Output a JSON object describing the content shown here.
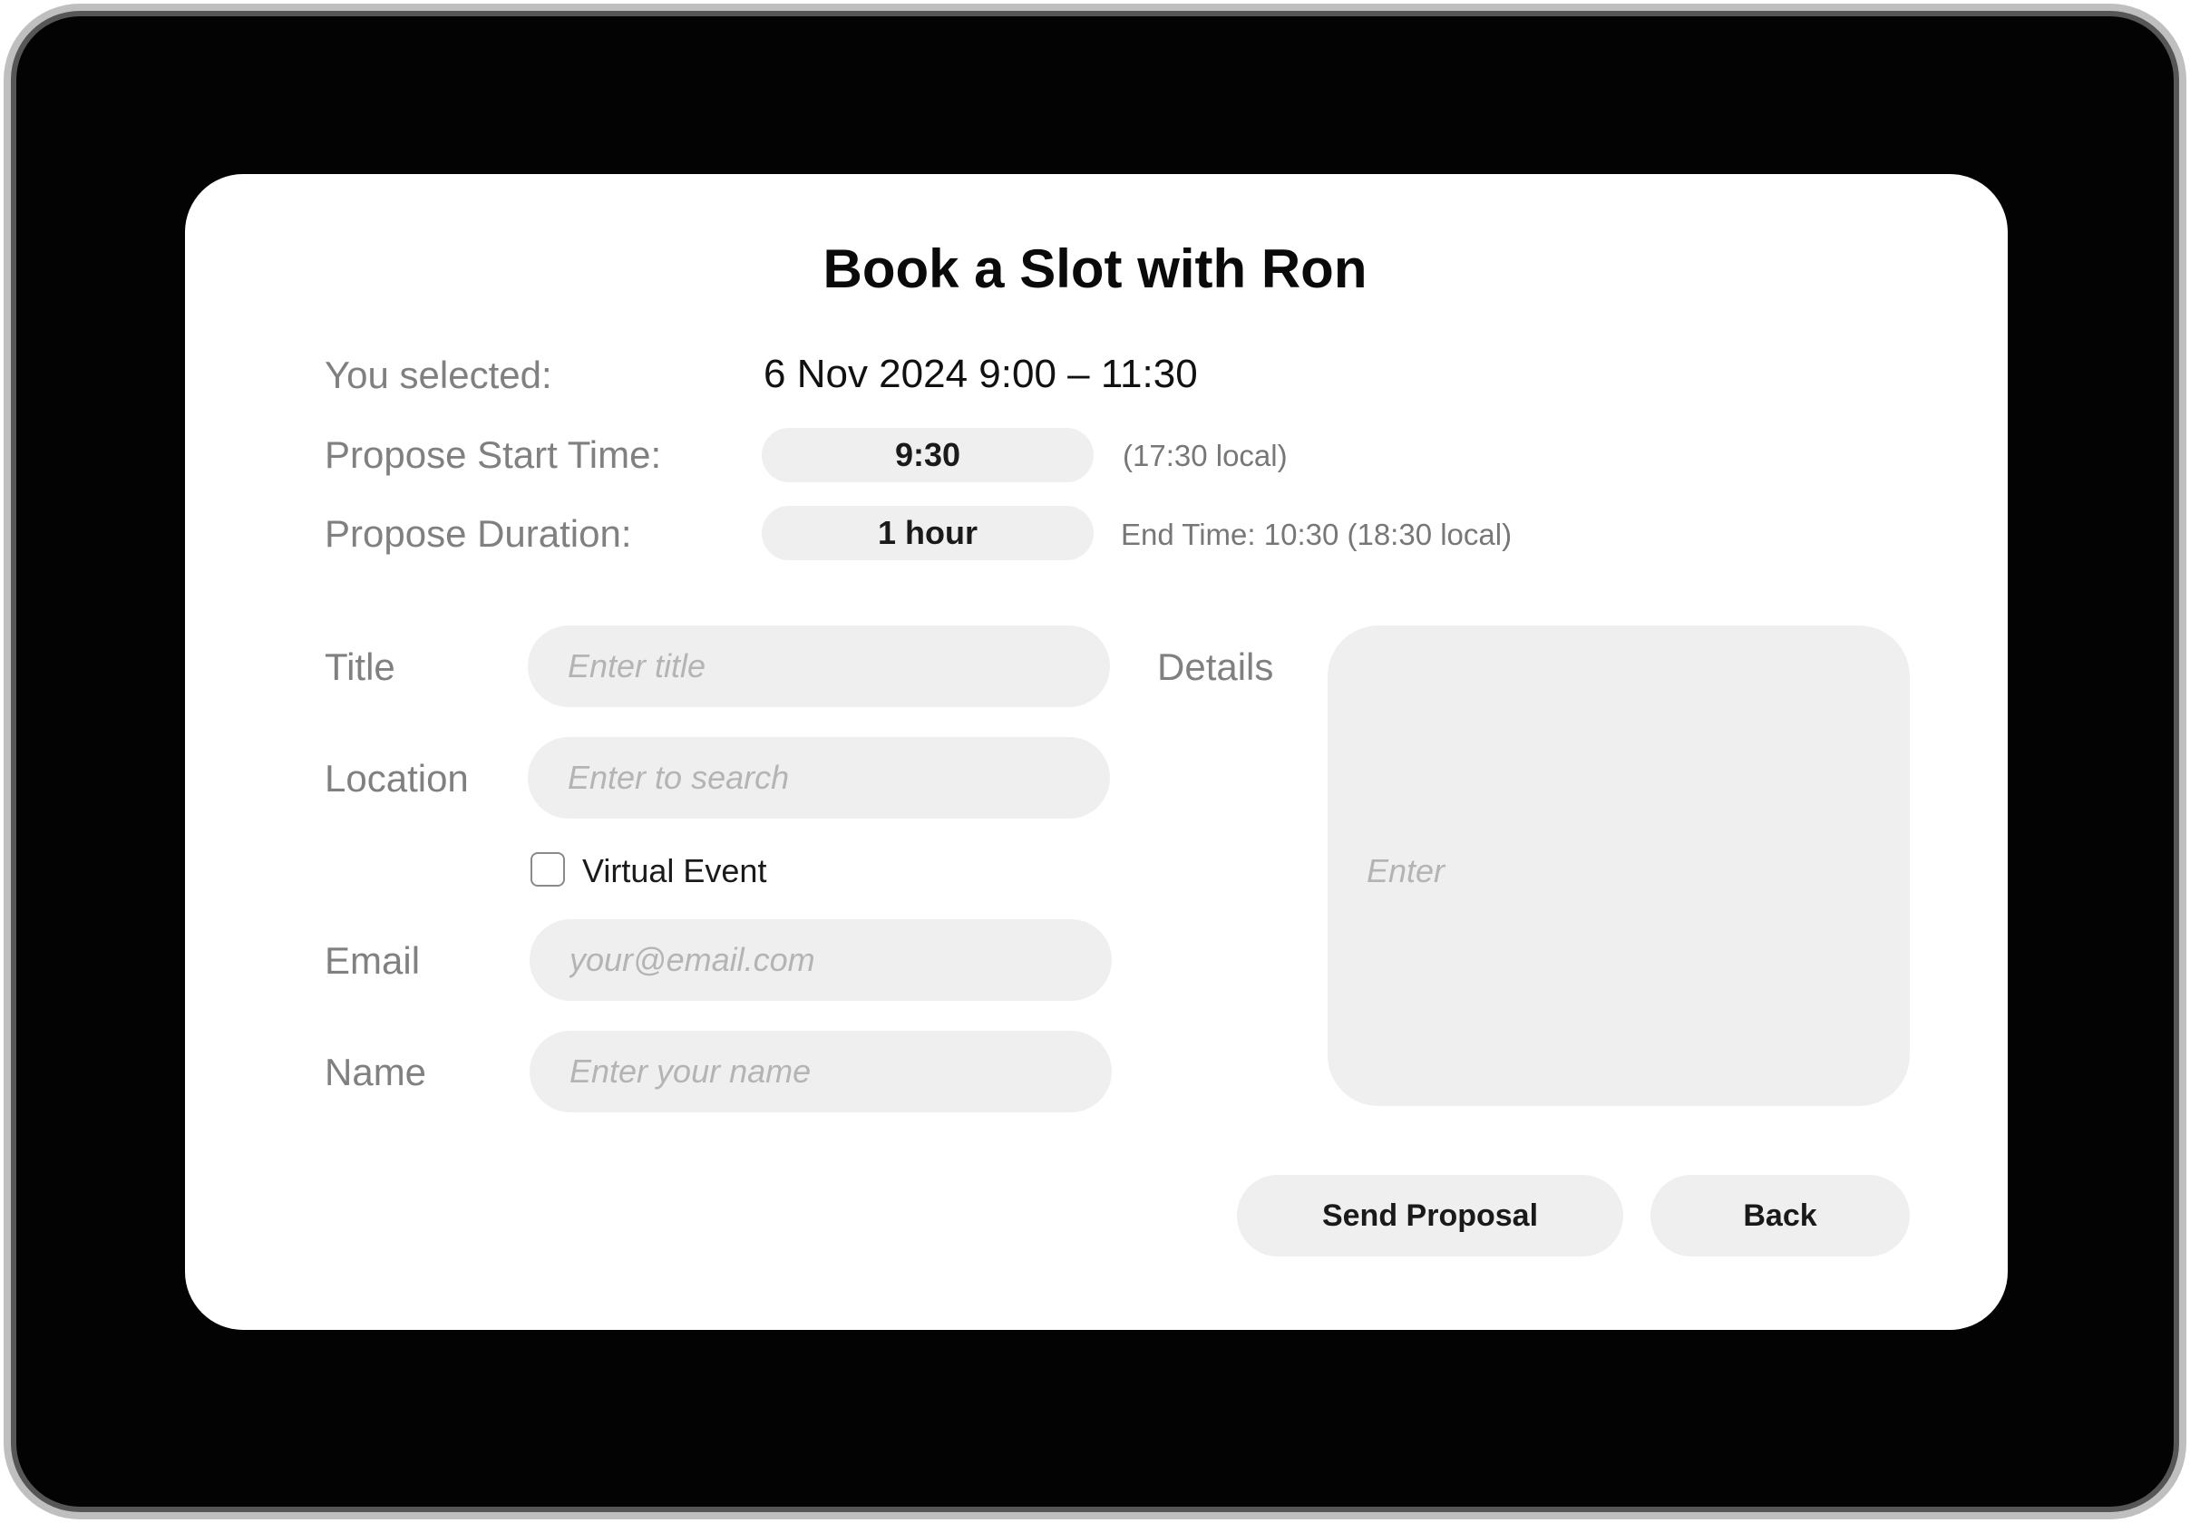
{
  "dialog": {
    "title": "Book a Slot with Ron"
  },
  "selection": {
    "label": "You selected:",
    "value": "6 Nov 2024 9:00 – 11:30"
  },
  "start_time": {
    "label": "Propose Start Time:",
    "value": "9:30",
    "note": "(17:30 local)"
  },
  "duration": {
    "label": "Propose Duration:",
    "value": "1 hour",
    "note": "End Time: 10:30 (18:30 local)"
  },
  "form": {
    "title_label": "Title",
    "title_placeholder": "Enter title",
    "location_label": "Location",
    "location_placeholder": "Enter to search",
    "virtual_label": "Virtual Event",
    "virtual_checked": false,
    "email_label": "Email",
    "email_placeholder": "your@email.com",
    "name_label": "Name",
    "name_placeholder": "Enter your name",
    "details_label": "Details",
    "details_placeholder": "Enter"
  },
  "actions": {
    "send_label": "Send Proposal",
    "back_label": "Back"
  }
}
